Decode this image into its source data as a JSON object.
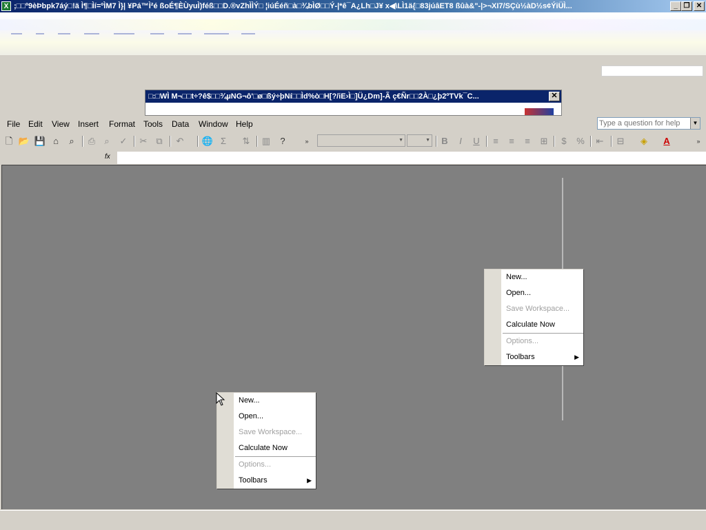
{
  "window": {
    "title": ";□□º9èÞbpk7áý□!ä Ì¶□Ìí=ºÌM7 Ì}| ¥Pá™Ì²é ßoÉ¶ÈÙyuÌ)féß□□D.®vZhÌÌÝ□ ¦iúÉéñ□à□¾bÌØ□□Ý-|*ê¯A¿Lh□J¥ x◀\\LÌ1ä{□83júâET8 ßûà&\"-|>¬XI7/SÇù½àD½s¢ÝiÜÌ...",
    "app_icon": "excel-icon",
    "buttons": {
      "minimize": "_",
      "restore": "❐",
      "close": "✕"
    }
  },
  "dialog_fragment": {
    "title": "□:□WÌ M¬□□t÷?ê$□□¾µNG¬ô'□ø□ßý÷þNí□□Ìd%ò□H[?/iE›Ì□]Ü¿Dm]-Ã ç€Ñr□□2À□¿þ2ºTVk¯C...",
    "close": "✕"
  },
  "menubar": {
    "items": [
      {
        "label": "File"
      },
      {
        "label": "Edit"
      },
      {
        "label": "View"
      },
      {
        "label": "Insert"
      },
      {
        "label": "Format"
      },
      {
        "label": "Tools"
      },
      {
        "label": "Data"
      },
      {
        "label": "Window"
      },
      {
        "label": "Help"
      }
    ],
    "help_placeholder": "Type a question for help"
  },
  "toolbar": {
    "icons": [
      "new-icon",
      "open-icon",
      "save-icon",
      "permission-icon",
      "print-preview-icon",
      "print-icon",
      "spelling-icon",
      "cut-icon",
      "copy-icon",
      "undo-icon",
      "hyperlink-icon",
      "autosum-icon",
      "sort-icon",
      "chart-wizard-icon",
      "help-icon",
      "toolbar-options-icon",
      "bold-icon",
      "italic-icon",
      "underline-icon",
      "align-left-icon",
      "align-center-icon",
      "align-right-icon",
      "merge-icon",
      "currency-icon",
      "percent-icon",
      "decrease-indent-icon",
      "borders-icon",
      "fill-color-icon",
      "font-color-icon"
    ],
    "glyphs": {
      "bold": "B",
      "italic": "I",
      "underline": "U",
      "currency": "$",
      "percent": "%",
      "autosum": "Σ",
      "font_color": "A",
      "fx": "fx"
    }
  },
  "context_menus": [
    {
      "items": [
        {
          "label": "New...",
          "enabled": true
        },
        {
          "label": "Open...",
          "enabled": true
        },
        {
          "label": "Save Workspace...",
          "enabled": false
        },
        {
          "label": "Calculate Now",
          "enabled": true
        },
        {
          "label": "Options...",
          "enabled": false
        },
        {
          "label": "Toolbars",
          "enabled": true,
          "submenu": "▶"
        }
      ]
    },
    {
      "items": [
        {
          "label": "New...",
          "enabled": true
        },
        {
          "label": "Open...",
          "enabled": true
        },
        {
          "label": "Save Workspace...",
          "enabled": false
        },
        {
          "label": "Calculate Now",
          "enabled": true
        },
        {
          "label": "Options...",
          "enabled": false
        },
        {
          "label": "Toolbars",
          "enabled": true,
          "submenu": "▶"
        }
      ]
    }
  ]
}
